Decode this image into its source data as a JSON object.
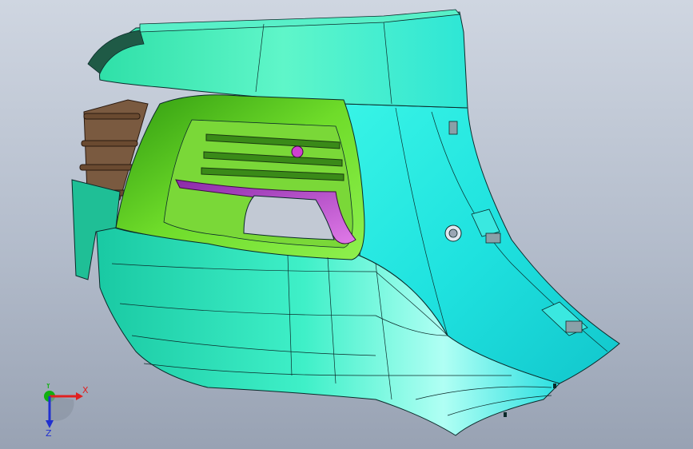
{
  "viewport": {
    "background_top": "#cfd6e1",
    "background_bottom": "#98a2b3"
  },
  "model": {
    "body_color": "#23e0b6",
    "body_highlight": "#66ffe0",
    "side_color": "#2af0e0",
    "side_highlight": "#b9fff6",
    "grille_color": "#55c21c",
    "grille_highlight": "#9df070",
    "vent_color": "#c850d8",
    "bracket_color": "#7a5a40",
    "edge_color": "#0b2a2a"
  },
  "triad": {
    "x_label": "X",
    "y_label": "Y",
    "z_label": "Z",
    "x_color": "#e02020",
    "y_color": "#10b010",
    "z_color": "#2030d0"
  }
}
